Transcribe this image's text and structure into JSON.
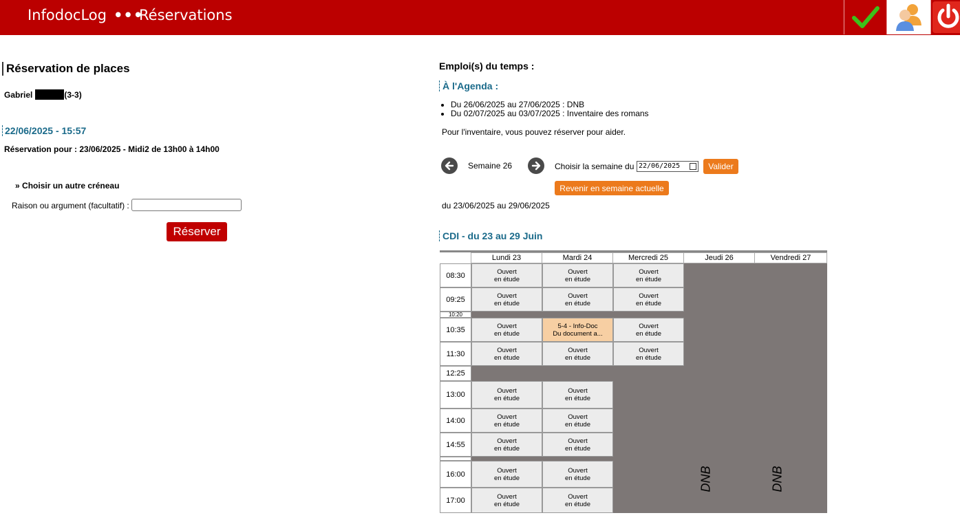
{
  "header": {
    "app_title": "InfodocLog",
    "separator": "•••",
    "page_title": "Réservations",
    "icons": [
      "check-icon",
      "users-icon",
      "power-icon"
    ],
    "bar_color": "#bb0000"
  },
  "left": {
    "title": "Réservation de places",
    "user_first_name": "Gabriel",
    "user_class": "(3-3)",
    "current_datetime": "22/06/2025 - 15:57",
    "reservation_for": "Réservation pour : 23/06/2025 - Midi2 de 13h00 à 14h00",
    "other_slot_label": "Choisir un autre créneau",
    "reason_label": "Raison ou argument (facultatif) :",
    "reason_value": "",
    "reserve_button": "Réserver"
  },
  "right": {
    "edt_title": "Emploi(s) du temps :",
    "agenda_title": "À l'Agenda :",
    "agenda_items": [
      "Du 26/06/2025 au 27/06/2025 : DNB",
      "Du 02/07/2025 au 03/07/2025 : Inventaire des romans"
    ],
    "agenda_note": "Pour l'inventaire, vous pouvez réserver pour aider.",
    "week_label": "Semaine 26",
    "choose_week_label": "Choisir la semaine du",
    "week_input_value": "22/06/2025",
    "validate_button": "Valider",
    "current_week_button": "Revenir en semaine actuelle",
    "date_range": "du 23/06/2025 au 29/06/2025",
    "cdi_title": "CDI - du 23 au 29 Juin"
  },
  "timetable": {
    "days": [
      "Lundi 23",
      "Mardi 24",
      "Mercredi 25",
      "Jeudi 26",
      "Vendredi 27"
    ],
    "times": [
      "08:30",
      "09:25",
      "10:20",
      "10:35",
      "11:30",
      "12:25",
      "13:00",
      "14:00",
      "14:55",
      "16:00",
      "17:00"
    ],
    "open_line1": "Ouvert",
    "open_line2": "en étude",
    "booked_line1": "5-4 - Info-Doc",
    "booked_line2": "Du document a...",
    "closed_label": "DNB",
    "colors": {
      "open": "#ececec",
      "booked": "#f7cfa3",
      "closed": "#7d7776",
      "button": "#ec7a1c"
    }
  }
}
